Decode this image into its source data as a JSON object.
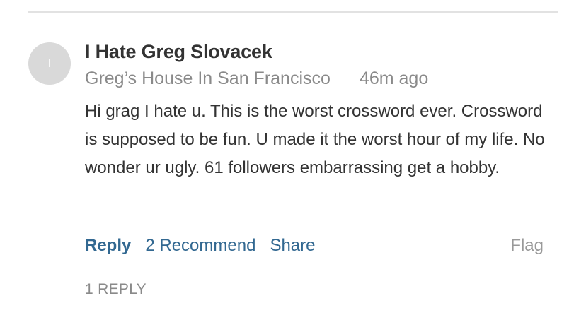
{
  "comment": {
    "avatar_initial": "I",
    "author": "I Hate Greg Slovacek",
    "location": "Greg’s House In San Francisco",
    "timestamp": "46m ago",
    "body": "Hi grag I hate u. This is the worst crossword ever. Crossword is supposed to be fun. U made it the worst hour of my life. No wonder ur ugly. 61 followers embarrassing get a hobby."
  },
  "actions": {
    "reply_label": "Reply",
    "recommend_label": "2 Recommend",
    "share_label": "Share",
    "flag_label": "Flag"
  },
  "replies": {
    "toggle_label": "1 REPLY"
  },
  "colors": {
    "link": "#326891",
    "muted": "#8a8a8a",
    "avatar_bg": "#d9d9d9"
  }
}
